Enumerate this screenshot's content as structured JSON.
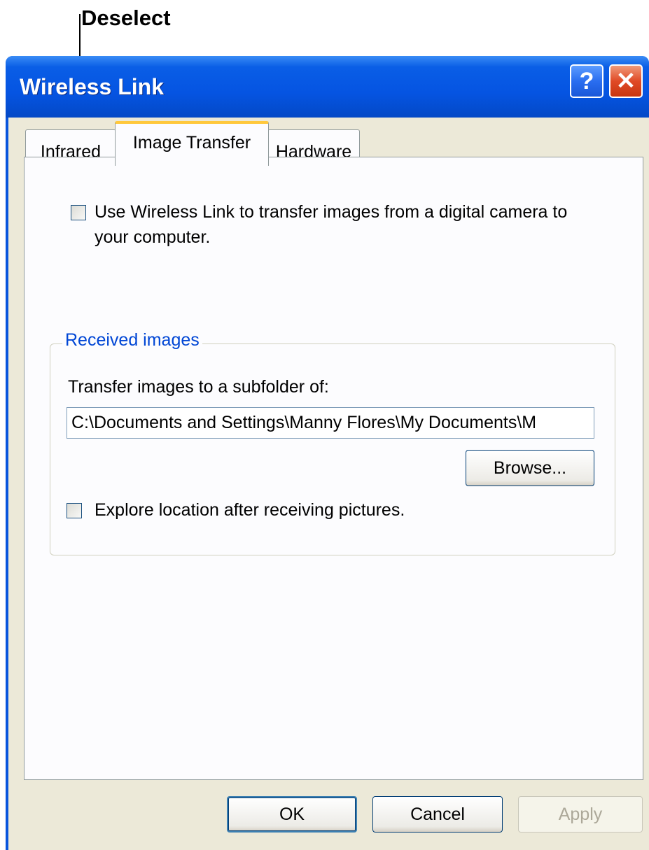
{
  "callout": {
    "label": "Deselect"
  },
  "window": {
    "title": "Wireless Link",
    "help_label": "?",
    "close_label": "✕"
  },
  "tabs": [
    {
      "label": "Infrared",
      "selected": false
    },
    {
      "label": "Image Transfer",
      "selected": true
    },
    {
      "label": "Hardware",
      "selected": false
    }
  ],
  "image_transfer": {
    "use_wireless_checkbox": {
      "checked": false,
      "label_line1": "Use Wireless Link to transfer images from a digital camera to",
      "label_line2": "your computer."
    },
    "received_images": {
      "title": "Received images",
      "subfolder_label": "Transfer images to a subfolder of:",
      "path_value": "C:\\Documents and Settings\\Manny Flores\\My Documents\\M",
      "browse_label": "Browse...",
      "explore_checkbox": {
        "checked": false,
        "label": "Explore location after receiving pictures."
      }
    }
  },
  "buttons": {
    "ok": "OK",
    "cancel": "Cancel",
    "apply": "Apply",
    "apply_enabled": false
  },
  "colors": {
    "titlebar": "#0554e2",
    "tab_highlight": "#ffc83c",
    "group_title": "#0046d5",
    "dialog_face": "#ece9d8"
  }
}
